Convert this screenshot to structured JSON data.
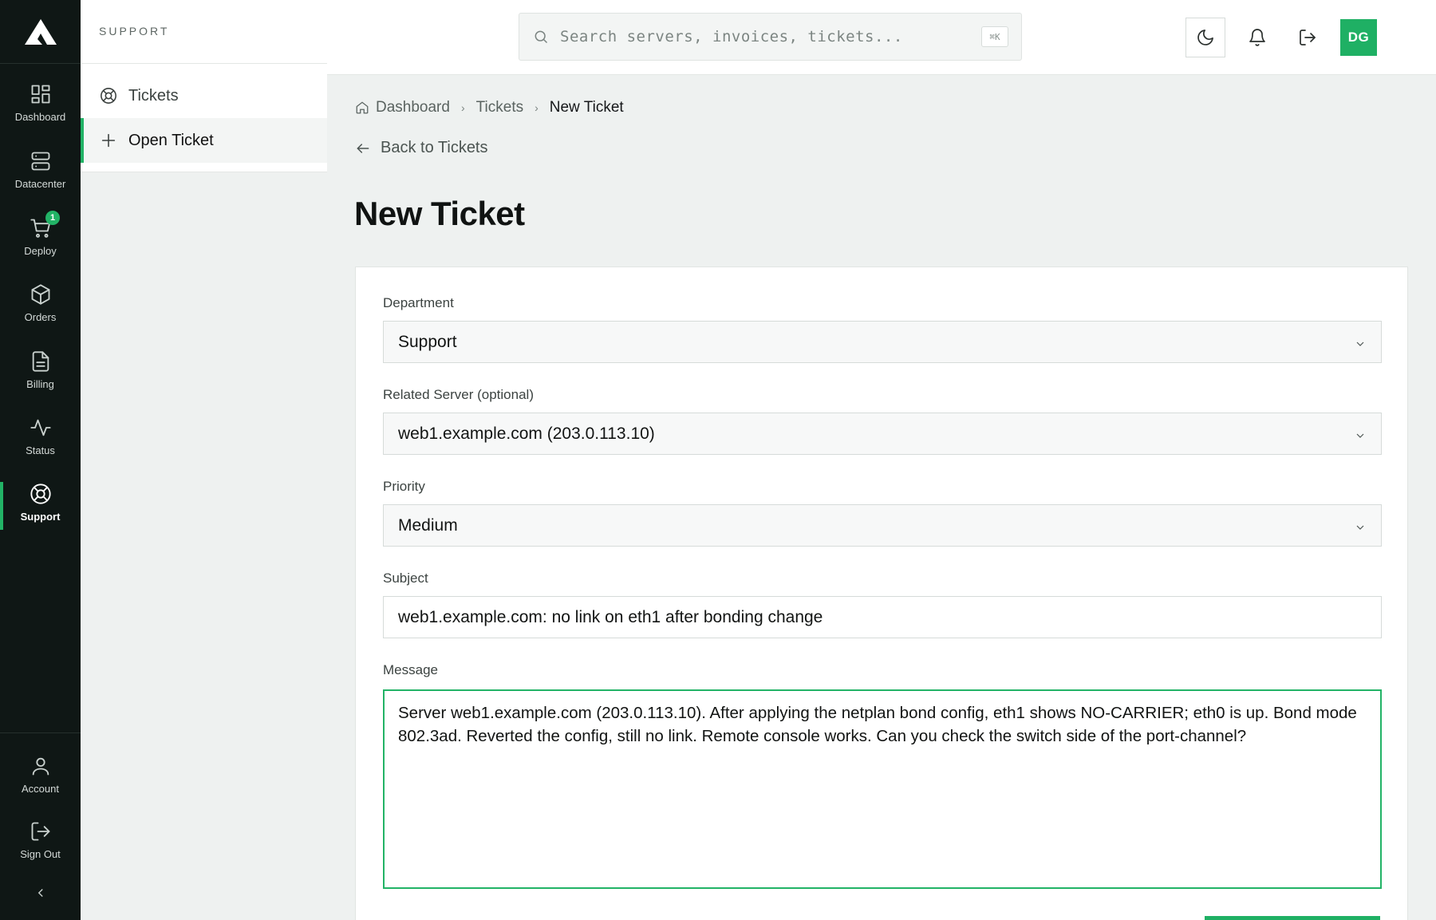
{
  "rail": {
    "items": [
      {
        "label": "Dashboard",
        "icon": "grid-icon"
      },
      {
        "label": "Datacenter",
        "icon": "server-icon"
      },
      {
        "label": "Deploy",
        "icon": "cart-icon",
        "badge": "1"
      },
      {
        "label": "Orders",
        "icon": "package-icon"
      },
      {
        "label": "Billing",
        "icon": "document-icon"
      },
      {
        "label": "Status",
        "icon": "activity-icon"
      },
      {
        "label": "Support",
        "icon": "lifebuoy-icon",
        "active": true
      }
    ],
    "bottom_items": [
      {
        "label": "Account",
        "icon": "user-icon"
      },
      {
        "label": "Sign Out",
        "icon": "logout-icon"
      }
    ],
    "accent": "#22b366"
  },
  "subnav": {
    "title": "SUPPORT",
    "items": [
      {
        "label": "Tickets",
        "icon": "lifebuoy-icon"
      },
      {
        "label": "Open Ticket",
        "icon": "plus-icon",
        "active": true
      }
    ]
  },
  "topbar": {
    "search_placeholder": "Search servers, invoices, tickets...",
    "search_shortcut": "⌘K",
    "avatar_initials": "DG"
  },
  "breadcrumb": {
    "items": [
      "Dashboard",
      "Tickets",
      "New Ticket"
    ]
  },
  "back_link": "Back to Tickets",
  "page_title": "New Ticket",
  "form": {
    "department": {
      "label": "Department",
      "value": "Support"
    },
    "server": {
      "label": "Related Server (optional)",
      "value": "web1.example.com (203.0.113.10)"
    },
    "priority": {
      "label": "Priority",
      "value": "Medium"
    },
    "subject": {
      "label": "Subject",
      "value": "web1.example.com: no link on eth1 after bonding change"
    },
    "message": {
      "label": "Message",
      "value": "Server web1.example.com (203.0.113.10). After applying the netplan bond config, eth1 shows NO-CARRIER; eth0 is up. Bond mode 802.3ad. Reverted the config, still no link. Remote console works. Can you check the switch side of the port-channel?"
    }
  }
}
